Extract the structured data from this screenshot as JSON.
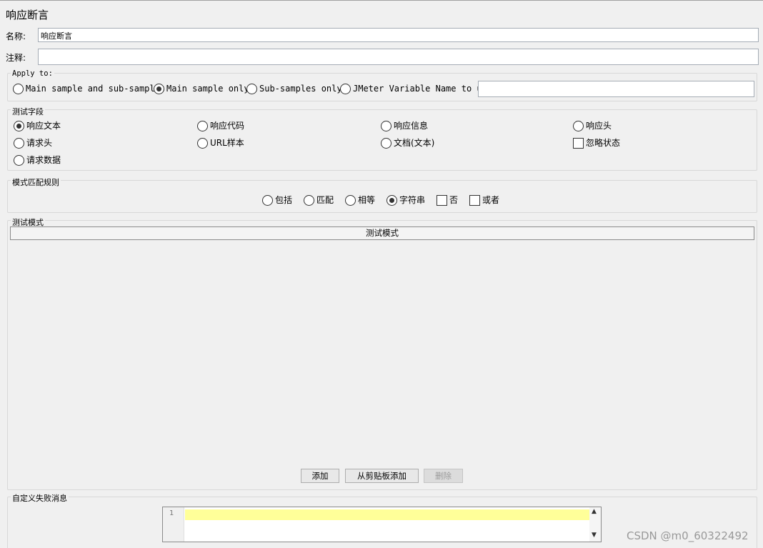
{
  "panel": {
    "title": "响应断言"
  },
  "name": {
    "label": "名称:",
    "value": "响应断言"
  },
  "comment": {
    "label": "注释:",
    "value": ""
  },
  "apply_to": {
    "legend": "Apply to:",
    "options": [
      "Main sample and sub-samples",
      "Main sample only",
      "Sub-samples only",
      "JMeter Variable Name to use"
    ],
    "selected": "Main sample only",
    "variable_value": ""
  },
  "test_field": {
    "legend": "测试字段",
    "options": [
      "响应文本",
      "响应代码",
      "响应信息",
      "响应头",
      "请求头",
      "URL样本",
      "文档(文本)",
      "请求数据"
    ],
    "selected": "响应文本",
    "ignore_status_label": "忽略状态",
    "ignore_status_checked": false
  },
  "matching_rules": {
    "legend": "模式匹配规则",
    "options": [
      "包括",
      "匹配",
      "相等",
      "字符串"
    ],
    "selected": "字符串",
    "not_label": "否",
    "or_label": "或者"
  },
  "patterns": {
    "legend": "测试模式",
    "column_header": "测试模式",
    "add_label": "添加",
    "add_clipboard_label": "从剪贴板添加",
    "delete_label": "删除"
  },
  "custom_message": {
    "legend": "自定义失败消息",
    "line_number": "1",
    "value": ""
  },
  "watermark": "CSDN @m0_60322492",
  "icons": {
    "scroll_up": "chevron-up-icon",
    "scroll_down": "chevron-down-icon"
  }
}
